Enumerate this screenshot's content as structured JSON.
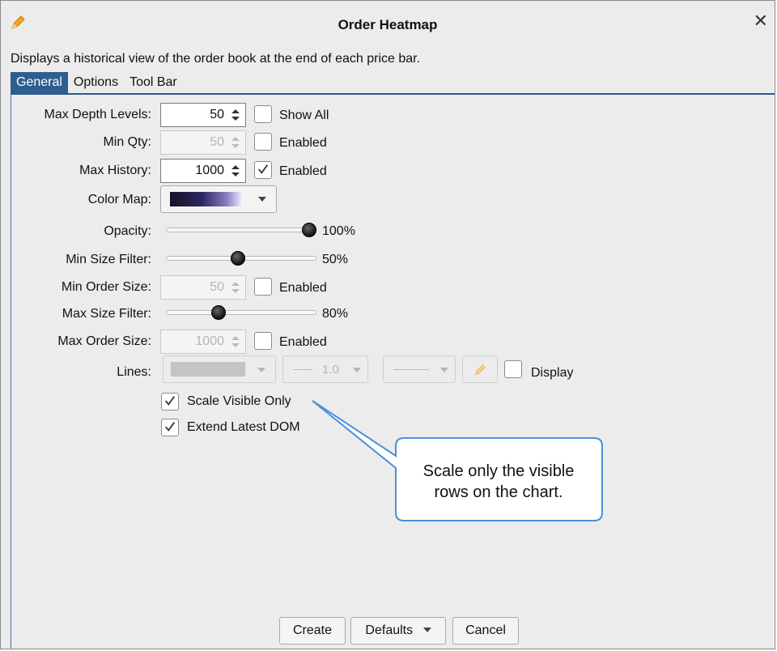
{
  "window": {
    "title": "Order Heatmap",
    "close_label": "✕",
    "description": "Displays a historical view of the order book at the end of each price bar."
  },
  "tabs": [
    {
      "label": "General",
      "active": true
    },
    {
      "label": "Options",
      "active": false
    },
    {
      "label": "Tool Bar",
      "active": false
    }
  ],
  "fields": {
    "max_depth_levels": {
      "label": "Max Depth Levels:",
      "value": "50",
      "check_label": "Show All",
      "checked": false
    },
    "min_qty": {
      "label": "Min Qty:",
      "value": "50",
      "check_label": "Enabled",
      "checked": false,
      "disabled": true
    },
    "max_history": {
      "label": "Max History:",
      "value": "1000",
      "check_label": "Enabled",
      "checked": true
    },
    "color_map": {
      "label": "Color Map:"
    },
    "opacity": {
      "label": "Opacity:",
      "value_text": "100%",
      "level": 1.0
    },
    "min_size_filter": {
      "label": "Min Size Filter:",
      "value_text": "50%",
      "level": 0.5
    },
    "min_order_size": {
      "label": "Min Order Size:",
      "value": "50",
      "check_label": "Enabled",
      "checked": false,
      "disabled": true
    },
    "max_size_filter": {
      "label": "Max Size Filter:",
      "value_text": "80%",
      "level": 0.37
    },
    "max_order_size": {
      "label": "Max Order Size:",
      "value": "1000",
      "check_label": "Enabled",
      "checked": false,
      "disabled": true
    },
    "lines": {
      "label": "Lines:",
      "width_value": "1.0",
      "display_label": "Display",
      "display_checked": false
    },
    "scale_visible_only": {
      "label": "Scale Visible Only",
      "checked": true
    },
    "extend_latest_dom": {
      "label": "Extend Latest DOM",
      "checked": true
    }
  },
  "callout": {
    "line1": "Scale only the visible",
    "line2": "rows on the chart."
  },
  "buttons": {
    "create": "Create",
    "defaults": "Defaults",
    "cancel": "Cancel"
  },
  "colors": {
    "accent": "#2e5e90",
    "callout_border": "#4a90d9",
    "pencil": "#f2a61c"
  }
}
